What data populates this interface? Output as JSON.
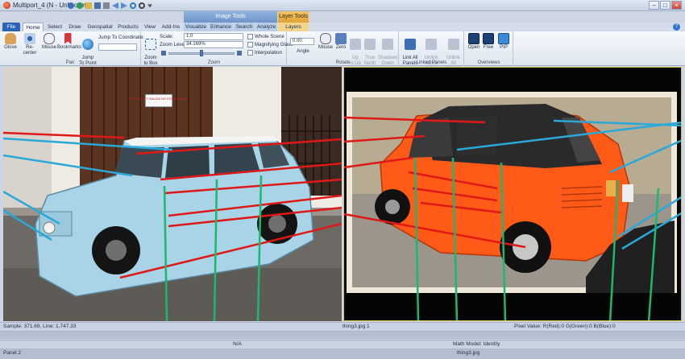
{
  "window": {
    "title": "Multiport_4 (N - Unknown)",
    "minimize": "–",
    "maximize": "□",
    "close": "×"
  },
  "context_groups": {
    "image_tools": "Image Tools",
    "layer_tools": "Layer Tools"
  },
  "tabs": [
    "File",
    "Home",
    "Select",
    "Draw",
    "Geospatial",
    "Products",
    "View",
    "Add-Ins",
    "Visualize",
    "Enhance",
    "Search",
    "Analyze",
    "Layers"
  ],
  "ribbon": {
    "pan": {
      "label": "Pan",
      "glove": "Glove",
      "recenter": "Re-center",
      "mouse": "Mouse",
      "bookmarks": "Bookmarks",
      "jump_to_point": "Jump\nTo Point",
      "jump_to_coordinate": "Jump To Coordinate:"
    },
    "zoom": {
      "label": "Zoom",
      "zoom_to_box": "Zoom\nto Box",
      "scale_label": "Scale:",
      "scale_value": "1:0",
      "zoom_level_label": "Zoom Level:",
      "zoom_level_value": "34.169%",
      "whole_scene": "Whole Scene",
      "magnifying_glass": "Magnifying Glass",
      "interpolation": "Interpolation"
    },
    "rotate": {
      "label": "Rotate",
      "angle_value": "0.00",
      "angle_label": "Angle",
      "mouse": "Mouse",
      "zero": "Zero",
      "up_is_up": "Up\nis Up",
      "true_north": "True\nNorth",
      "shadows_down": "Shadows\nDown"
    },
    "linked_panels": {
      "label": "Linked Panels",
      "link_all": "Link All\nPanels",
      "unlink_active": "Unlink\nActive Panel",
      "unlink_all": "Unlink\nAll Panels"
    },
    "overviews": {
      "label": "Overviews",
      "open": "Open",
      "free": "Free",
      "pip": "PIP"
    }
  },
  "panels": {
    "left": {
      "sign_text": "ENTRADA Y SALIDA NO ESTACIONAR"
    }
  },
  "status": {
    "sample_line": "Sample: 371.69, Line: 1,747.33",
    "file1": "thing3.jpg 1",
    "pixel_value": "Pixel Value: R(Red):0 G(Green):0 B(Blue):0",
    "na": "N/A",
    "math_model": "Math Model: Identity",
    "panel": "Panel.2",
    "file2": "thing3.jpg"
  },
  "colors": {
    "tie_red": "#e01818",
    "tie_blue": "#2aa8d8",
    "tie_green": "#1db870",
    "active_border": "#d9c34a"
  }
}
